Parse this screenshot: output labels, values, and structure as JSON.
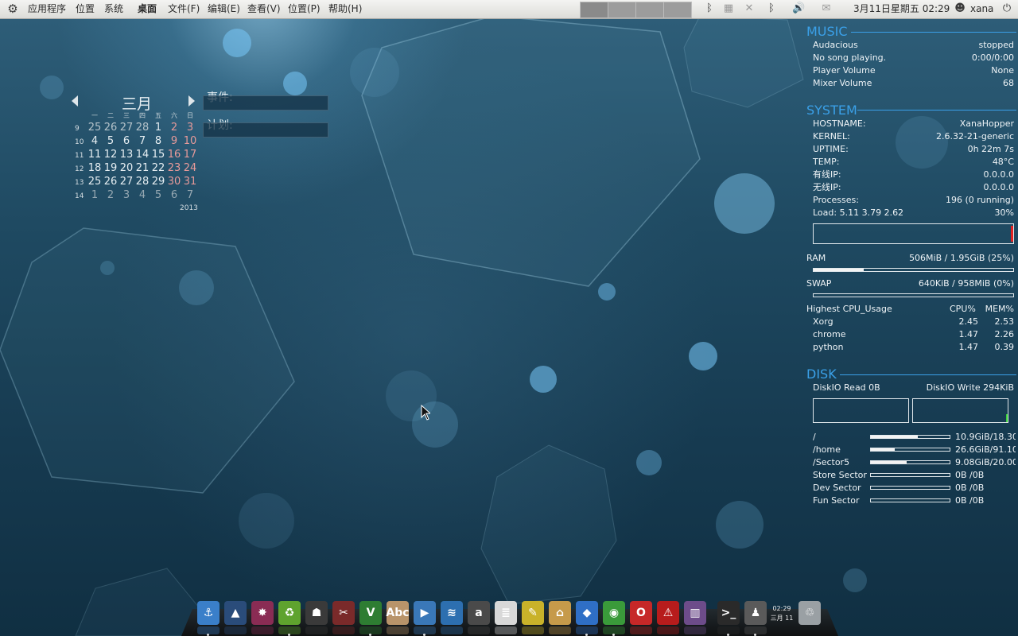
{
  "top_panel": {
    "menu": [
      "应用程序",
      "位置",
      "系统"
    ],
    "desktop": "桌面",
    "app_menu": [
      "文件(F)",
      "编辑(E)",
      "查看(V)",
      "位置(P)",
      "帮助(H)"
    ],
    "clock": "3月11日星期五 02:29",
    "user": "xana"
  },
  "calendar": {
    "month": "三月",
    "year": "2013",
    "weekdays": [
      "一",
      "二",
      "三",
      "四",
      "五",
      "六",
      "日"
    ],
    "weeks": [
      {
        "wk": "9",
        "days": [
          "25",
          "26",
          "27",
          "28",
          "1",
          "2",
          "3"
        ]
      },
      {
        "wk": "10",
        "days": [
          "4",
          "5",
          "6",
          "7",
          "8",
          "9",
          "10"
        ]
      },
      {
        "wk": "11",
        "days": [
          "11",
          "12",
          "13",
          "14",
          "15",
          "16",
          "17"
        ]
      },
      {
        "wk": "12",
        "days": [
          "18",
          "19",
          "20",
          "21",
          "22",
          "23",
          "24"
        ]
      },
      {
        "wk": "13",
        "days": [
          "25",
          "26",
          "27",
          "28",
          "29",
          "30",
          "31"
        ]
      },
      {
        "wk": "14",
        "days": [
          "1",
          "2",
          "3",
          "4",
          "5",
          "6",
          "7"
        ]
      }
    ],
    "events_label": "事件:",
    "plans_label": "计划:"
  },
  "conky": {
    "music": {
      "title": "MUSIC",
      "rows": [
        {
          "label": "Audacious",
          "value": "stopped"
        },
        {
          "label": "No song playing.",
          "value": "0:00/0:00"
        },
        {
          "label": "Player Volume",
          "value": "None"
        },
        {
          "label": "Mixer Volume",
          "value": "68"
        }
      ]
    },
    "system": {
      "title": "SYSTEM",
      "rows": [
        {
          "label": "HOSTNAME:",
          "value": "XanaHopper"
        },
        {
          "label": "KERNEL:",
          "value": "2.6.32-21-generic"
        },
        {
          "label": "UPTIME:",
          "value": "0h 22m 7s"
        },
        {
          "label": "TEMP:",
          "value": "48°C"
        },
        {
          "label": "有线IP:",
          "value": "0.0.0.0"
        },
        {
          "label": "无线IP:",
          "value": "0.0.0.0"
        },
        {
          "label": "Processes:",
          "value": "196 (0 running)"
        },
        {
          "label": "Load: 5.11 3.79 2.62",
          "value": "30%"
        }
      ],
      "ram_label": "RAM",
      "ram_value": "506MiB / 1.95GiB (25%)",
      "ram_fraction": 0.25,
      "swap_label": "SWAP",
      "swap_value": "640KiB / 958MiB (0%)",
      "swap_fraction": 0.0,
      "top_header": {
        "label": "Highest CPU_Usage",
        "cpu": "CPU%",
        "mem": "MEM%"
      },
      "top": [
        {
          "name": "Xorg",
          "cpu": "2.45",
          "mem": "2.53"
        },
        {
          "name": "chrome",
          "cpu": "1.47",
          "mem": "2.26"
        },
        {
          "name": "python",
          "cpu": "1.47",
          "mem": "0.39"
        }
      ]
    },
    "disk": {
      "title": "DISK",
      "read": "DiskIO Read 0B",
      "write": "DiskIO Write 294KiB",
      "mounts": [
        {
          "name": "/",
          "value": "10.9GiB/18.30",
          "fraction": 0.6
        },
        {
          "name": "/home",
          "value": "26.6GiB/91.10",
          "fraction": 0.3
        },
        {
          "name": "/Sector5",
          "value": "9.08GiB/20.00",
          "fraction": 0.45
        },
        {
          "name": "Store Sector",
          "value": "0B  /0B",
          "fraction": 0
        },
        {
          "name": "Dev Sector",
          "value": "0B  /0B",
          "fraction": 0
        },
        {
          "name": "Fun Sector",
          "value": "0B  /0B",
          "fraction": 0
        }
      ]
    }
  },
  "dock": {
    "items": [
      {
        "name": "anchor-icon",
        "glyph": "⚓",
        "color": "#3a7fc9"
      },
      {
        "name": "matlab-icon",
        "glyph": "▲",
        "color": "#2a4c7a"
      },
      {
        "name": "spark-icon",
        "glyph": "✸",
        "color": "#8a2c54"
      },
      {
        "name": "recycle-green-icon",
        "glyph": "♻",
        "color": "#5fa32e"
      },
      {
        "name": "warrior-game-icon",
        "glyph": "☗",
        "color": "#3a3a3a"
      },
      {
        "name": "tools-icon",
        "glyph": "✂",
        "color": "#7a2a2a"
      },
      {
        "name": "vim-icon",
        "glyph": "V",
        "color": "#2e7d32"
      },
      {
        "name": "dictionary-icon",
        "glyph": "Abc",
        "color": "#b8946a"
      },
      {
        "name": "video-player-icon",
        "glyph": "▶",
        "color": "#3a78b8"
      },
      {
        "name": "openoffice-icon",
        "glyph": "≋",
        "color": "#2d6fb0"
      },
      {
        "name": "amazon-icon",
        "glyph": "a",
        "color": "#4a4a4a"
      },
      {
        "name": "notes-icon",
        "glyph": "≣",
        "color": "#d8d8d8"
      },
      {
        "name": "editor-icon",
        "glyph": "✎",
        "color": "#c9b22a"
      },
      {
        "name": "home-folder-icon",
        "glyph": "⌂",
        "color": "#c69a4a"
      },
      {
        "name": "cubes-icon",
        "glyph": "◆",
        "color": "#2f6fc6"
      },
      {
        "name": "chrome-icon",
        "glyph": "◉",
        "color": "#3a9a3a"
      },
      {
        "name": "opera-icon",
        "glyph": "O",
        "color": "#c62828"
      },
      {
        "name": "pdf-reader-icon",
        "glyph": "⚠",
        "color": "#b71c1c"
      },
      {
        "name": "calibre-books-icon",
        "glyph": "▥",
        "color": "#6d4c8a"
      },
      {
        "name": "terminal-icon",
        "glyph": ">_",
        "color": "#2a2a2a"
      },
      {
        "name": "agent-icon",
        "glyph": "♟",
        "color": "#5a5a5a"
      }
    ],
    "clock_time": "02:29",
    "clock_date": "三月 11",
    "trash": {
      "name": "trash-icon",
      "glyph": "♲",
      "color": "#9aa0a4"
    }
  }
}
